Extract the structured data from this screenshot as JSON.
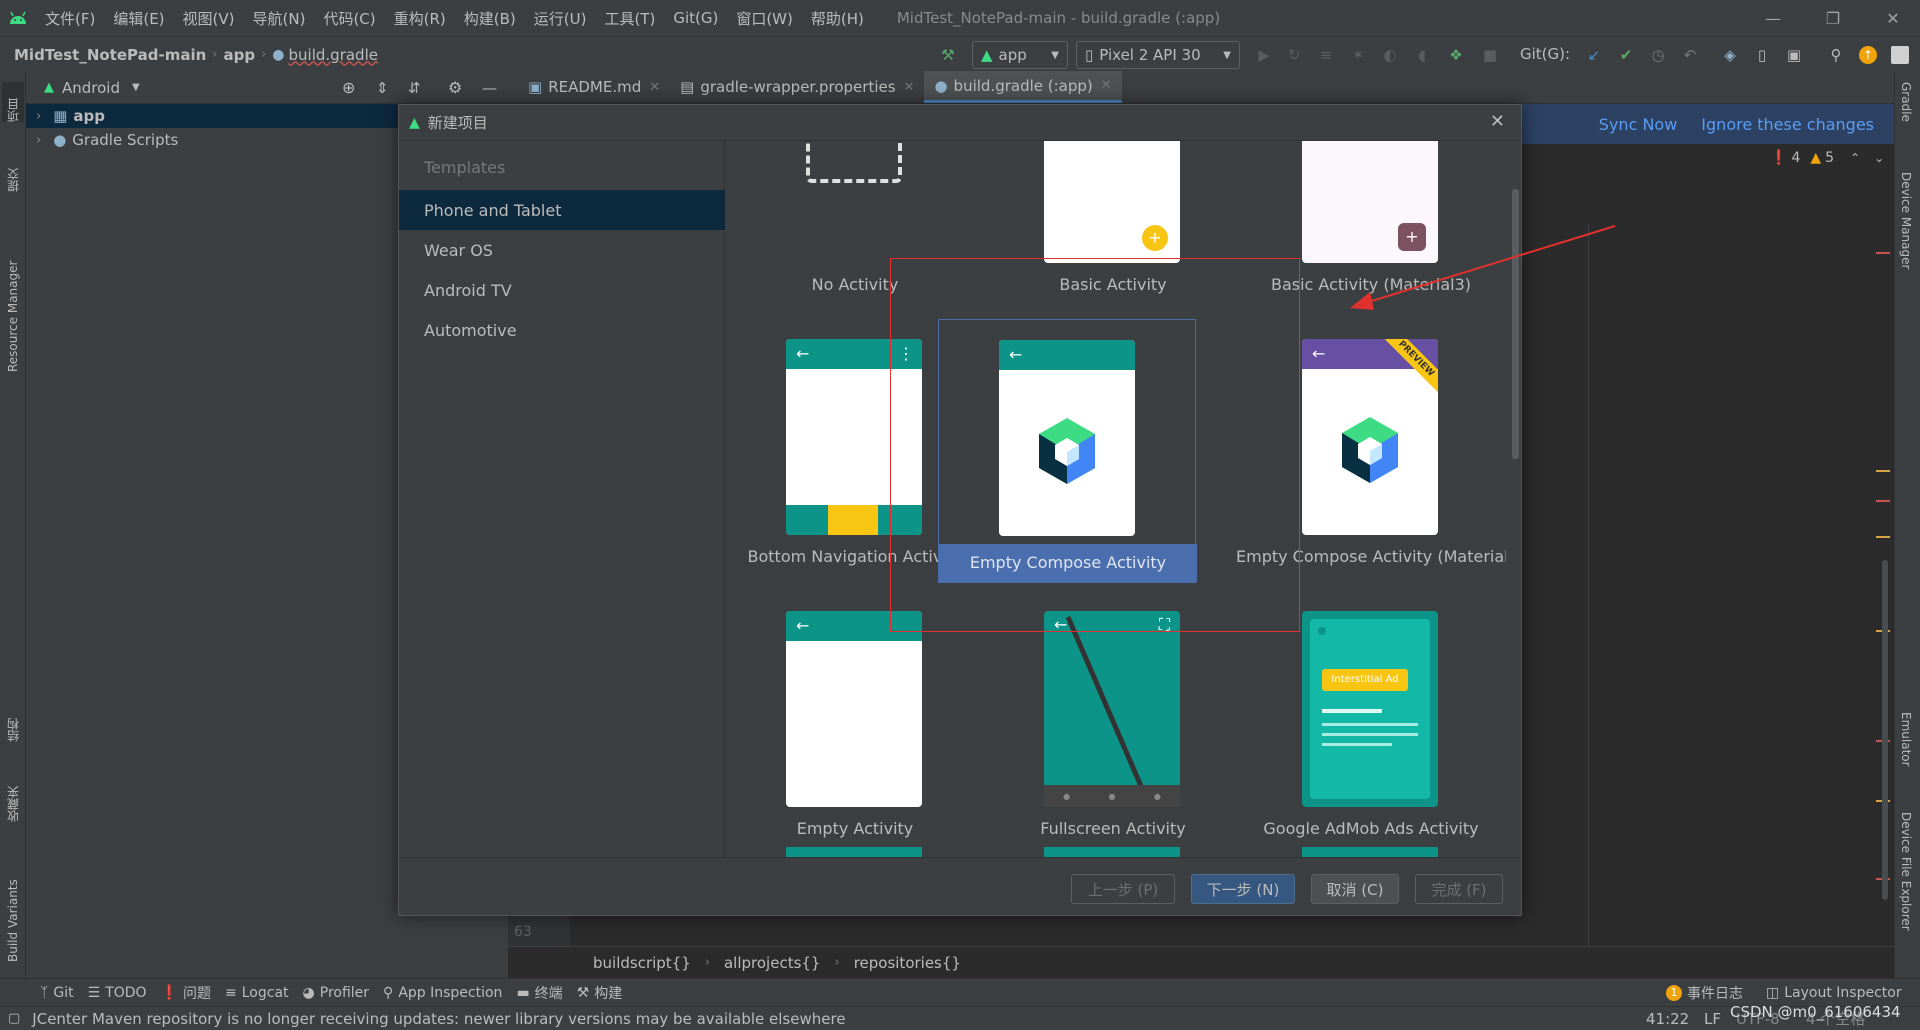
{
  "menubar": {
    "items": [
      {
        "label": "文件(F)"
      },
      {
        "label": "编辑(E)"
      },
      {
        "label": "视图(V)"
      },
      {
        "label": "导航(N)"
      },
      {
        "label": "代码(C)"
      },
      {
        "label": "重构(R)"
      },
      {
        "label": "构建(B)"
      },
      {
        "label": "运行(U)"
      },
      {
        "label": "工具(T)"
      },
      {
        "label": "Git(G)"
      },
      {
        "label": "窗口(W)"
      },
      {
        "label": "帮助(H)"
      }
    ],
    "window_title": "MidTest_NotePad-main - build.gradle (:app)"
  },
  "toolbar": {
    "project": "MidTest_NotePad-main",
    "module": "app",
    "file": "build.gradle",
    "run_config": "app",
    "device": "Pixel 2 API 30",
    "git_label": "Git(G):"
  },
  "left_strip": {
    "project_tab": "项目",
    "resource_manager": "Resource Manager",
    "structure": "结构",
    "favorites": "收藏夹",
    "build_variants": "Build Variants",
    "commit": "提交"
  },
  "right_strip": {
    "gradle": "Gradle",
    "device_manager": "Device Manager",
    "emulator": "Emulator",
    "device_file_explorer": "Device File Explorer"
  },
  "project_panel": {
    "view_mode": "Android",
    "tree": [
      {
        "label": "app",
        "selected": true
      },
      {
        "label": "Gradle Scripts",
        "selected": false
      }
    ]
  },
  "editor": {
    "tabs": [
      {
        "label": "README.md",
        "active": false
      },
      {
        "label": "gradle-wrapper.properties",
        "active": false
      },
      {
        "label": "build.gradle (:app)",
        "active": true
      }
    ],
    "sync_now": "Sync Now",
    "ignore_changes": "Ignore these changes",
    "errors": "4",
    "warnings": "5",
    "line_number": "63",
    "breadcrumbs": [
      "buildscript{}",
      "allprojects{}",
      "repositories{}"
    ]
  },
  "dialog": {
    "title": "新建项目",
    "categories_header": "Templates",
    "categories": [
      {
        "label": "Phone and Tablet",
        "selected": true
      },
      {
        "label": "Wear OS",
        "selected": false
      },
      {
        "label": "Android TV",
        "selected": false
      },
      {
        "label": "Automotive",
        "selected": false
      }
    ],
    "templates": [
      {
        "label": "No Activity"
      },
      {
        "label": "Basic Activity"
      },
      {
        "label": "Basic Activity (Material3)"
      },
      {
        "label": "Bottom Navigation Activity"
      },
      {
        "label": "Empty Compose Activity",
        "selected": true
      },
      {
        "label": "Empty Compose Activity (Material..."
      },
      {
        "label": "Empty Activity"
      },
      {
        "label": "Fullscreen Activity"
      },
      {
        "label": "Google AdMob Ads Activity"
      }
    ],
    "admob_badge": "Interstitial Ad",
    "preview_ribbon": "PREVIEW",
    "buttons": {
      "previous": "上一步 (P)",
      "next": "下一步 (N)",
      "cancel": "取消 (C)",
      "finish": "完成 (F)"
    }
  },
  "bottom_tools": [
    {
      "label": "Git",
      "icon": "git-branch-icon"
    },
    {
      "label": "TODO",
      "icon": "list-icon"
    },
    {
      "label": "问题",
      "icon": "problem-icon"
    },
    {
      "label": "Logcat",
      "icon": "logcat-icon"
    },
    {
      "label": "Profiler",
      "icon": "gauge-icon"
    },
    {
      "label": "App Inspection",
      "icon": "inspection-icon"
    },
    {
      "label": "终端",
      "icon": "terminal-icon"
    },
    {
      "label": "构建",
      "icon": "hammer-icon"
    }
  ],
  "bottom_right": {
    "event_log_count": "1",
    "event_log": "事件日志",
    "layout_inspector": "Layout Inspector"
  },
  "status_bar": {
    "message": "JCenter Maven repository is no longer receiving updates: newer library versions may be available elsewhere",
    "position": "41:22",
    "line_sep": "LF",
    "encoding": "UTF-8",
    "indent": "4 个空格",
    "watermark": "CSDN @m0_61606434"
  },
  "colors": {
    "accent_teal": "#0d9488",
    "android_green": "#3ddc84",
    "selection_blue": "#4b6eaf",
    "annotation_red": "#e0312f"
  }
}
